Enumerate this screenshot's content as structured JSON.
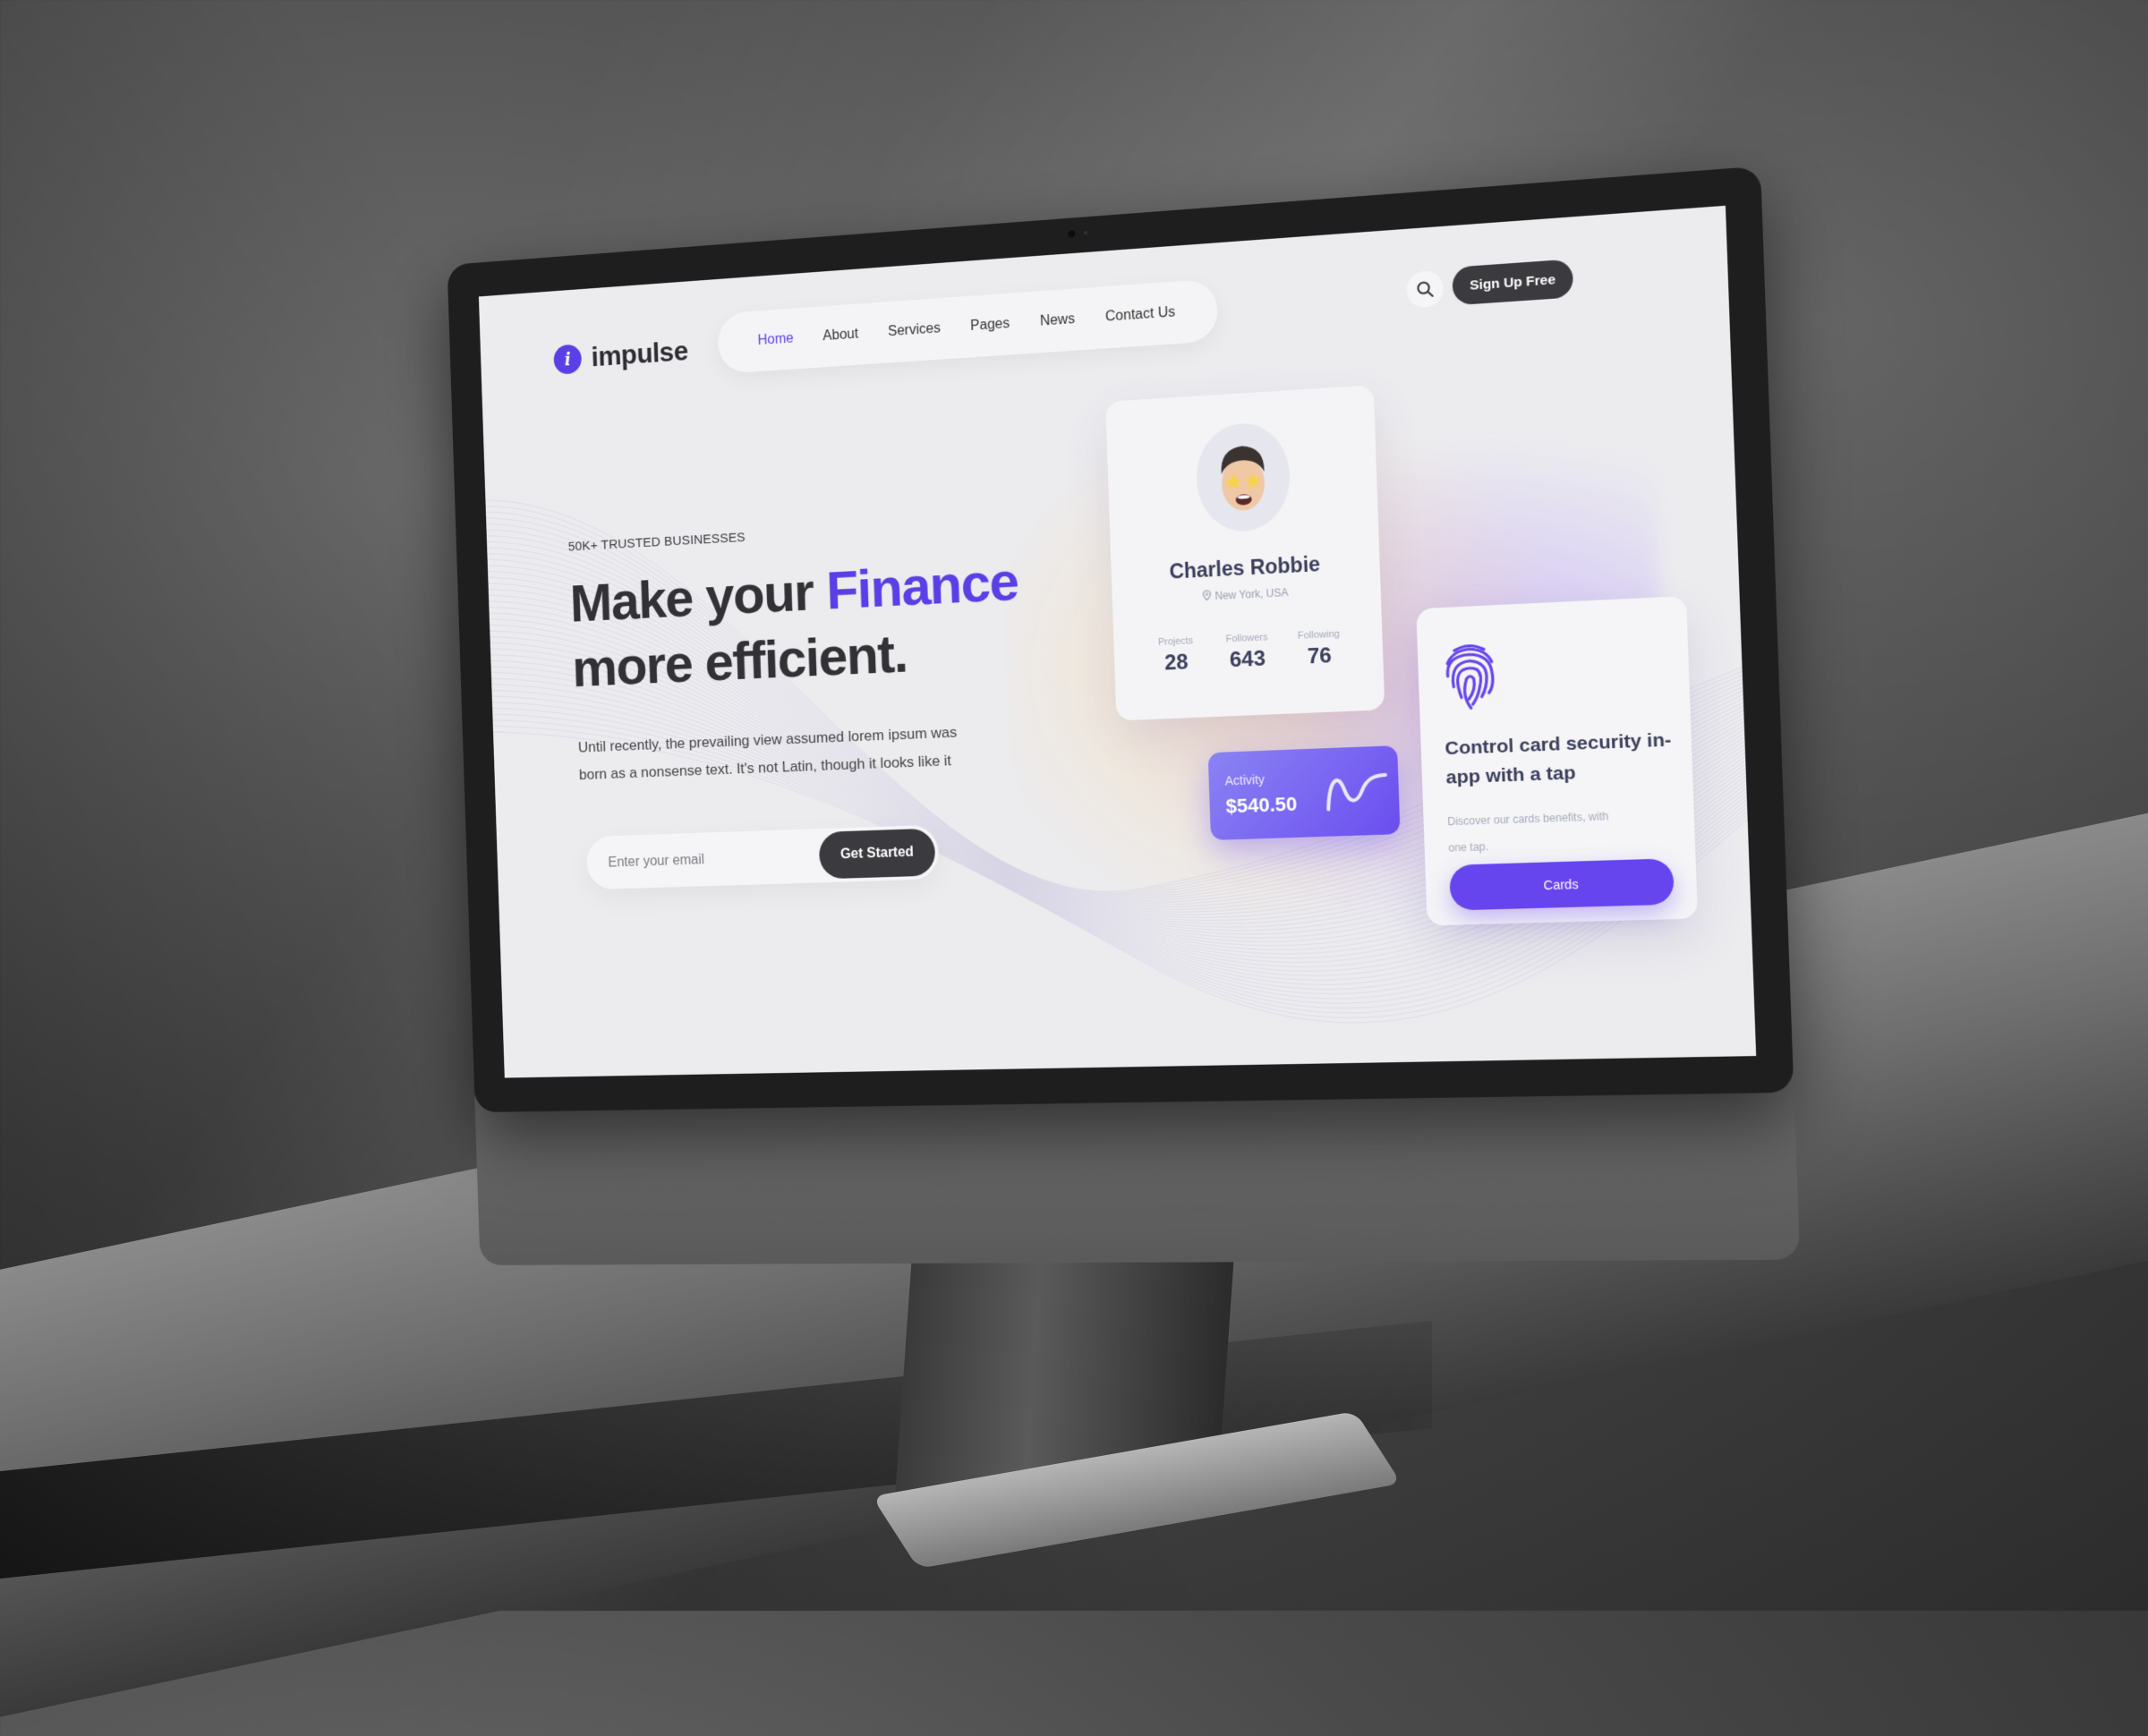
{
  "brand": {
    "name": "impulse",
    "mark": "i",
    "accent_color": "#5b3fe6"
  },
  "nav": {
    "items": [
      {
        "label": "Home",
        "active": true
      },
      {
        "label": "About",
        "active": false
      },
      {
        "label": "Services",
        "active": false
      },
      {
        "label": "Pages",
        "active": false
      },
      {
        "label": "News",
        "active": false
      },
      {
        "label": "Contact Us",
        "active": false
      }
    ],
    "search_icon": "search-icon",
    "signup_label": "Sign Up Free"
  },
  "hero": {
    "eyebrow": "50K+ TRUSTED BUSINESSES",
    "headline_part1": "Make your ",
    "headline_accent": "Finance",
    "headline_part2": "more efficient.",
    "subtext": "Until recently, the prevailing view assumed lorem ipsum was born as a nonsense text. It's not Latin, though it looks like it",
    "email_placeholder": "Enter your email",
    "email_value": "",
    "cta_label": "Get Started"
  },
  "profile_card": {
    "avatar": "memoji-star-eyes-avatar",
    "name": "Charles Robbie",
    "location_icon": "location-pin-icon",
    "location": "New York, USA",
    "stats": [
      {
        "label": "Projects",
        "value": "28"
      },
      {
        "label": "Followers",
        "value": "643"
      },
      {
        "label": "Following",
        "value": "76"
      }
    ]
  },
  "activity_card": {
    "label": "Activity",
    "value": "$540.50",
    "icon": "sparkline-icon",
    "colors": [
      "#8a83f3",
      "#6b4ef0"
    ]
  },
  "security_card": {
    "icon": "fingerprint-icon",
    "title": "Control card security in-app with a tap",
    "description": "Discover our cards benefits, with one tap.",
    "button_label": "Cards",
    "button_color": "#6645ee"
  }
}
